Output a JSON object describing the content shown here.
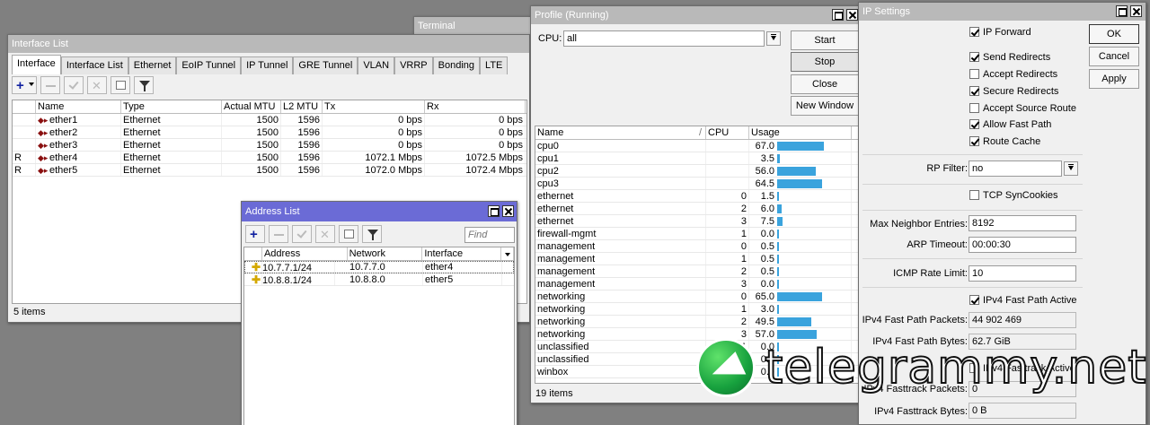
{
  "terminal": {
    "title": "Terminal"
  },
  "interface_list": {
    "title": "Interface List",
    "tabs": [
      "Interface",
      "Interface List",
      "Ethernet",
      "EoIP Tunnel",
      "IP Tunnel",
      "GRE Tunnel",
      "VLAN",
      "VRRP",
      "Bonding",
      "LTE"
    ],
    "columns": [
      "",
      "Name",
      "Type",
      "Actual MTU",
      "L2 MTU",
      "Tx",
      "Rx"
    ],
    "rows": [
      {
        "flag": "",
        "name": "ether1",
        "type": "Ethernet",
        "mtu": "1500",
        "l2mtu": "1596",
        "tx": "0 bps",
        "rx": "0 bps"
      },
      {
        "flag": "",
        "name": "ether2",
        "type": "Ethernet",
        "mtu": "1500",
        "l2mtu": "1596",
        "tx": "0 bps",
        "rx": "0 bps"
      },
      {
        "flag": "",
        "name": "ether3",
        "type": "Ethernet",
        "mtu": "1500",
        "l2mtu": "1596",
        "tx": "0 bps",
        "rx": "0 bps"
      },
      {
        "flag": "R",
        "name": "ether4",
        "type": "Ethernet",
        "mtu": "1500",
        "l2mtu": "1596",
        "tx": "1072.1 Mbps",
        "rx": "1072.5 Mbps"
      },
      {
        "flag": "R",
        "name": "ether5",
        "type": "Ethernet",
        "mtu": "1500",
        "l2mtu": "1596",
        "tx": "1072.0 Mbps",
        "rx": "1072.4 Mbps"
      }
    ],
    "status": "5 items"
  },
  "address_list": {
    "title": "Address List",
    "find_placeholder": "Find",
    "columns": [
      "Address",
      "Network",
      "Interface"
    ],
    "rows": [
      {
        "address": "10.7.7.1/24",
        "network": "10.7.7.0",
        "interface": "ether4"
      },
      {
        "address": "10.8.8.1/24",
        "network": "10.8.8.0",
        "interface": "ether5"
      }
    ]
  },
  "profile": {
    "title": "Profile (Running)",
    "cpu_label": "CPU:",
    "cpu_value": "all",
    "buttons": {
      "start": "Start",
      "stop": "Stop",
      "close": "Close",
      "new_window": "New Window"
    },
    "columns": [
      "Name",
      "CPU",
      "Usage"
    ],
    "rows": [
      {
        "name": "cpu0",
        "cpu": "",
        "usage": 67.0
      },
      {
        "name": "cpu1",
        "cpu": "",
        "usage": 3.5
      },
      {
        "name": "cpu2",
        "cpu": "",
        "usage": 56.0
      },
      {
        "name": "cpu3",
        "cpu": "",
        "usage": 64.5
      },
      {
        "name": "ethernet",
        "cpu": "0",
        "usage": 1.5
      },
      {
        "name": "ethernet",
        "cpu": "2",
        "usage": 6.0
      },
      {
        "name": "ethernet",
        "cpu": "3",
        "usage": 7.5
      },
      {
        "name": "firewall-mgmt",
        "cpu": "1",
        "usage": 0.0
      },
      {
        "name": "management",
        "cpu": "0",
        "usage": 0.5
      },
      {
        "name": "management",
        "cpu": "1",
        "usage": 0.5
      },
      {
        "name": "management",
        "cpu": "2",
        "usage": 0.5
      },
      {
        "name": "management",
        "cpu": "3",
        "usage": 0.0
      },
      {
        "name": "networking",
        "cpu": "0",
        "usage": 65.0
      },
      {
        "name": "networking",
        "cpu": "1",
        "usage": 3.0
      },
      {
        "name": "networking",
        "cpu": "2",
        "usage": 49.5
      },
      {
        "name": "networking",
        "cpu": "3",
        "usage": 57.0
      },
      {
        "name": "unclassified",
        "cpu": "1",
        "usage": 0.0
      },
      {
        "name": "unclassified",
        "cpu": "",
        "usage": 0.0
      },
      {
        "name": "winbox",
        "cpu": "",
        "usage": 0.0
      }
    ],
    "status": "19 items",
    "bar_color": "#3aa3dd"
  },
  "ip_settings": {
    "title": "IP Settings",
    "buttons": {
      "ok": "OK",
      "cancel": "Cancel",
      "apply": "Apply"
    },
    "checks": [
      {
        "label": "IP Forward",
        "checked": true
      },
      {
        "label": "Send Redirects",
        "checked": true
      },
      {
        "label": "Accept Redirects",
        "checked": false
      },
      {
        "label": "Secure Redirects",
        "checked": true
      },
      {
        "label": "Accept Source Route",
        "checked": false
      },
      {
        "label": "Allow Fast Path",
        "checked": true
      },
      {
        "label": "Route Cache",
        "checked": true
      }
    ],
    "rp_filter_label": "RP Filter:",
    "rp_filter_value": "no",
    "tcp_syncookies_label": "TCP SynCookies",
    "max_neighbor_label": "Max Neighbor Entries:",
    "max_neighbor_value": "8192",
    "arp_timeout_label": "ARP Timeout:",
    "arp_timeout_value": "00:00:30",
    "icmp_rate_label": "ICMP Rate Limit:",
    "icmp_rate_value": "10",
    "fastpath_active_label": "IPv4 Fast Path Active",
    "fp_packets_label": "IPv4 Fast Path Packets:",
    "fp_packets_value": "44 902 469",
    "fp_bytes_label": "IPv4 Fast Path Bytes:",
    "fp_bytes_value": "62.7 GiB",
    "ft_active_label": "IPv4 Fasttrack Active",
    "ft_packets_label": "IPv4 Fasttrack Packets:",
    "ft_packets_value": "0",
    "ft_bytes_label": "IPv4 Fasttrack Bytes:",
    "ft_bytes_value": "0 B"
  },
  "watermark": {
    "text": "telegrammy.net"
  }
}
